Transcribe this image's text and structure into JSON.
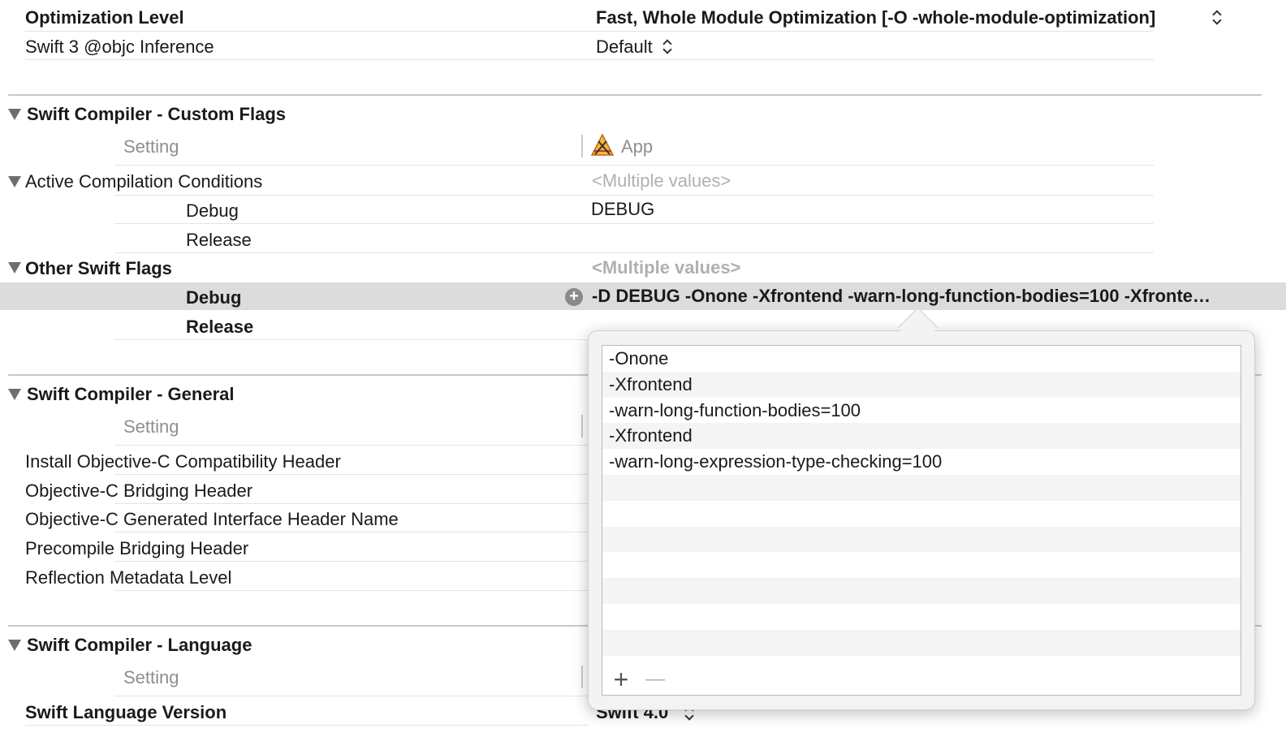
{
  "top_rows": [
    {
      "name": "Optimization Level",
      "value": "Fast, Whole Module Optimization  [-O -whole-module-optimization]"
    },
    {
      "name": "Swift 3 @objc Inference",
      "value": "Default"
    }
  ],
  "sections": {
    "custom_flags": {
      "title": "Swift Compiler - Custom Flags",
      "setting_header": "Setting",
      "target_name": "App",
      "active_compilation_conditions": {
        "name": "Active Compilation Conditions",
        "value": "<Multiple values>",
        "debug_label": "Debug",
        "debug_value": "DEBUG",
        "release_label": "Release"
      },
      "other_swift_flags": {
        "name": "Other Swift Flags",
        "value": "<Multiple values>",
        "debug_label": "Debug",
        "debug_value": "-D DEBUG -Onone -Xfrontend -warn-long-function-bodies=100 -Xfronte…",
        "release_label": "Release"
      }
    },
    "general": {
      "title": "Swift Compiler - General",
      "setting_header": "Setting",
      "rows": [
        "Install Objective-C Compatibility Header",
        "Objective-C Bridging Header",
        "Objective-C Generated Interface Header Name",
        "Precompile Bridging Header",
        "Reflection Metadata Level"
      ]
    },
    "language": {
      "title": "Swift Compiler - Language",
      "setting_header": "Setting",
      "row_name": "Swift Language Version",
      "row_value": "Swift 4.0"
    }
  },
  "popover": {
    "items": [
      "-Onone",
      "-Xfrontend",
      "-warn-long-function-bodies=100",
      "-Xfrontend",
      "-warn-long-expression-type-checking=100"
    ],
    "add_label": "+",
    "remove_label": "—"
  },
  "icons": [
    "disclosure-triangle-icon",
    "stepper-icon",
    "app-target-icon",
    "add-circle-icon"
  ],
  "colors": {
    "highlight": "#dcdcdc",
    "popover_bg": "#f3f3f3",
    "placeholder": "#b0b0b0"
  }
}
